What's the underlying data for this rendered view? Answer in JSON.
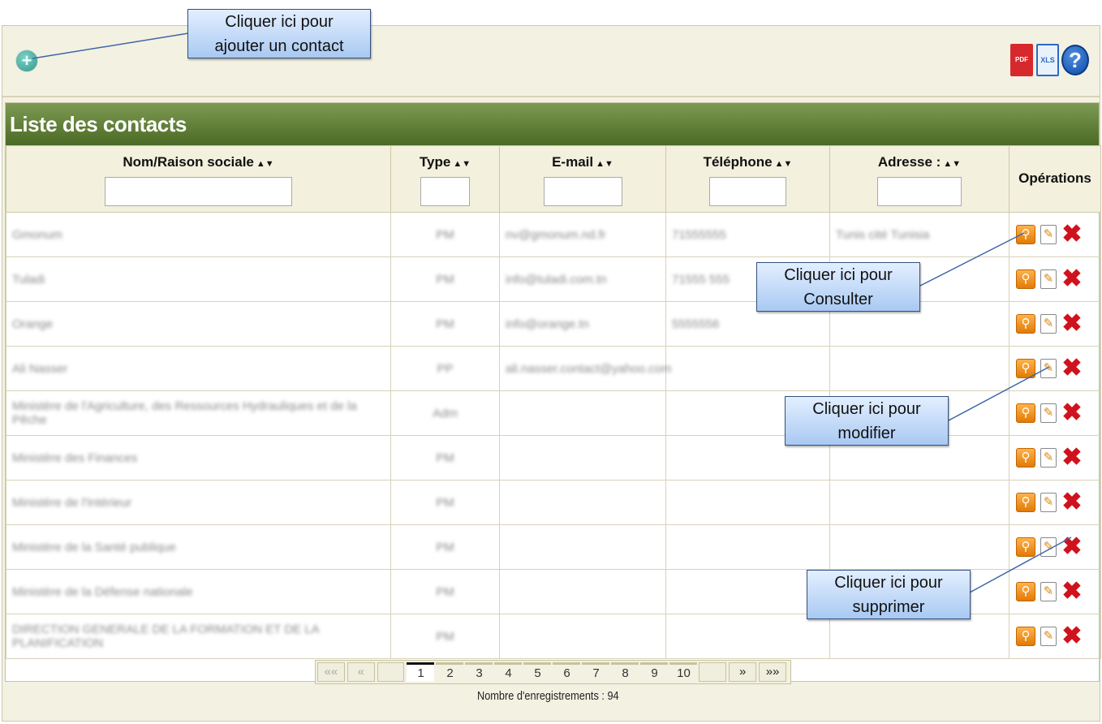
{
  "toolbar": {
    "add_symbol": "+",
    "pdf_label": "PDF",
    "xls_label": "XLS",
    "help_symbol": "?"
  },
  "panel": {
    "title": "Liste des contacts"
  },
  "columns": {
    "name": "Nom/Raison sociale",
    "type": "Type",
    "email": "E-mail",
    "phone": "Téléphone",
    "address": "Adresse :",
    "operations": "Opérations",
    "sort_symbol": "▲▼"
  },
  "rows": [
    {
      "name": "Gmonum",
      "type": "PM",
      "email": "nv@gmonum.nd.fr",
      "phone": "71555555",
      "address": "Tunis cité Tunisia"
    },
    {
      "name": "Tuladi",
      "type": "PM",
      "email": "info@tuladi.com.tn",
      "phone": "71555 555",
      "address": ""
    },
    {
      "name": "Orange",
      "type": "PM",
      "email": "info@orange.tn",
      "phone": "5555556",
      "address": ""
    },
    {
      "name": "Ali Nasser",
      "type": "PP",
      "email": "ali.nasser.contact@yahoo.com",
      "phone": "",
      "address": ""
    },
    {
      "name": "Ministère de l'Agriculture, des Ressources Hydrauliques et de la Pêche",
      "type": "Adm",
      "email": "",
      "phone": "",
      "address": ""
    },
    {
      "name": "Ministère des Finances",
      "type": "PM",
      "email": "",
      "phone": "",
      "address": ""
    },
    {
      "name": "Ministère de l'Intérieur",
      "type": "PM",
      "email": "",
      "phone": "",
      "address": ""
    },
    {
      "name": "Ministère de la Santé publique",
      "type": "PM",
      "email": "",
      "phone": "",
      "address": ""
    },
    {
      "name": "Ministère de la Défense nationale",
      "type": "PM",
      "email": "",
      "phone": "",
      "address": ""
    },
    {
      "name": "DIRECTION GENERALE DE LA FORMATION ET DE LA PLANIFICATION",
      "type": "PM",
      "email": "",
      "phone": "",
      "address": ""
    }
  ],
  "pager": {
    "first": "««",
    "prev": "«",
    "pages": [
      "1",
      "2",
      "3",
      "4",
      "5",
      "6",
      "7",
      "8",
      "9",
      "10"
    ],
    "current": "1",
    "next": "»",
    "last": "»»",
    "count_text": "Nombre d'enregistrements : 94"
  },
  "callouts": {
    "add": [
      "Cliquer ici pour",
      "ajouter un contact"
    ],
    "view": [
      "Cliquer ici pour",
      "Consulter"
    ],
    "edit": [
      "Cliquer ici pour",
      "modifier"
    ],
    "delete": [
      "Cliquer ici pour",
      "supprimer"
    ]
  },
  "colors": {
    "header_green": "#5e7d35",
    "callout_fill": "#bcd6f5",
    "delete_red": "#d0121c",
    "view_orange": "#f39a1c"
  }
}
